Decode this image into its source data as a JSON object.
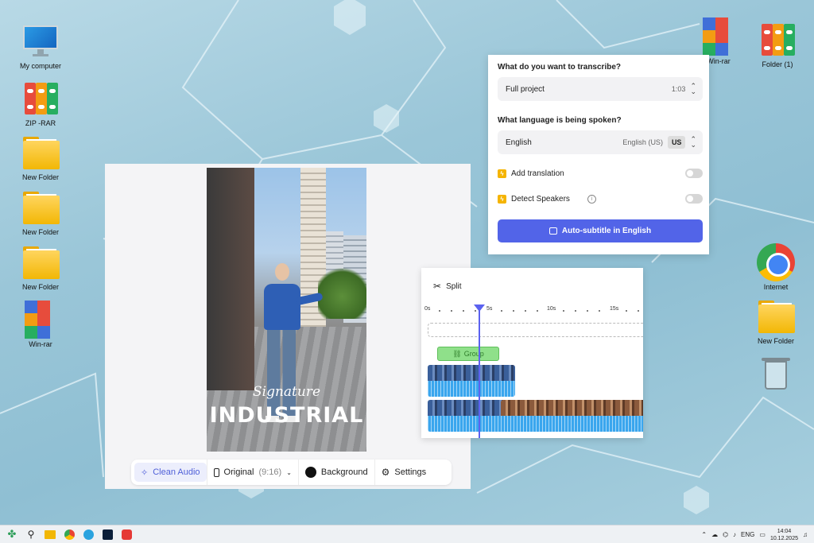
{
  "desktop": {
    "icons_left": [
      {
        "label": "My computer",
        "icon": "monitor-icon"
      },
      {
        "label": "ZIP -RAR",
        "icon": "binders-icon"
      },
      {
        "label": "New Folder",
        "icon": "folder-icon"
      },
      {
        "label": "New Folder",
        "icon": "folder-icon"
      },
      {
        "label": "New Folder",
        "icon": "folder-icon"
      },
      {
        "label": "Win-rar",
        "icon": "winrar-icon"
      }
    ],
    "icons_right": [
      {
        "label": "Win-rar",
        "icon": "winrar-icon"
      },
      {
        "label": "Folder (1)",
        "icon": "binders-icon"
      },
      {
        "label": "Internet",
        "icon": "chrome-icon"
      },
      {
        "label": "New Folder",
        "icon": "folder-icon"
      },
      {
        "label": "",
        "icon": "trash-icon"
      }
    ]
  },
  "editor": {
    "video_text": {
      "line1": "Signature",
      "line2": "INDUSTRIAL"
    },
    "toolbar": {
      "clean_audio": "Clean Audio",
      "original": "Original",
      "ratio": "(9:16)",
      "background": "Background",
      "settings": "Settings"
    }
  },
  "transcribe": {
    "question1": "What do you want to transcribe?",
    "scope_value": "Full project",
    "duration": "1:03",
    "question2": "What language is being spoken?",
    "language": "English",
    "language_variant": "English (US)",
    "language_code": "US",
    "add_translation": "Add translation",
    "detect_speakers": "Detect Speakers",
    "info_glyph": "i",
    "button": "Auto-subtitle in English"
  },
  "timeline": {
    "split_label": "Split",
    "ruler": [
      "0s",
      "5s",
      "10s",
      "15s"
    ],
    "group_label": "Group"
  },
  "taskbar": {
    "language": "ENG",
    "time": "14:04",
    "date": "10.12.2025"
  },
  "colors": {
    "accent": "#5264e8",
    "playhead": "#5b62f0",
    "group_green": "#8fe08a",
    "waveform": "#3aa6ee"
  }
}
